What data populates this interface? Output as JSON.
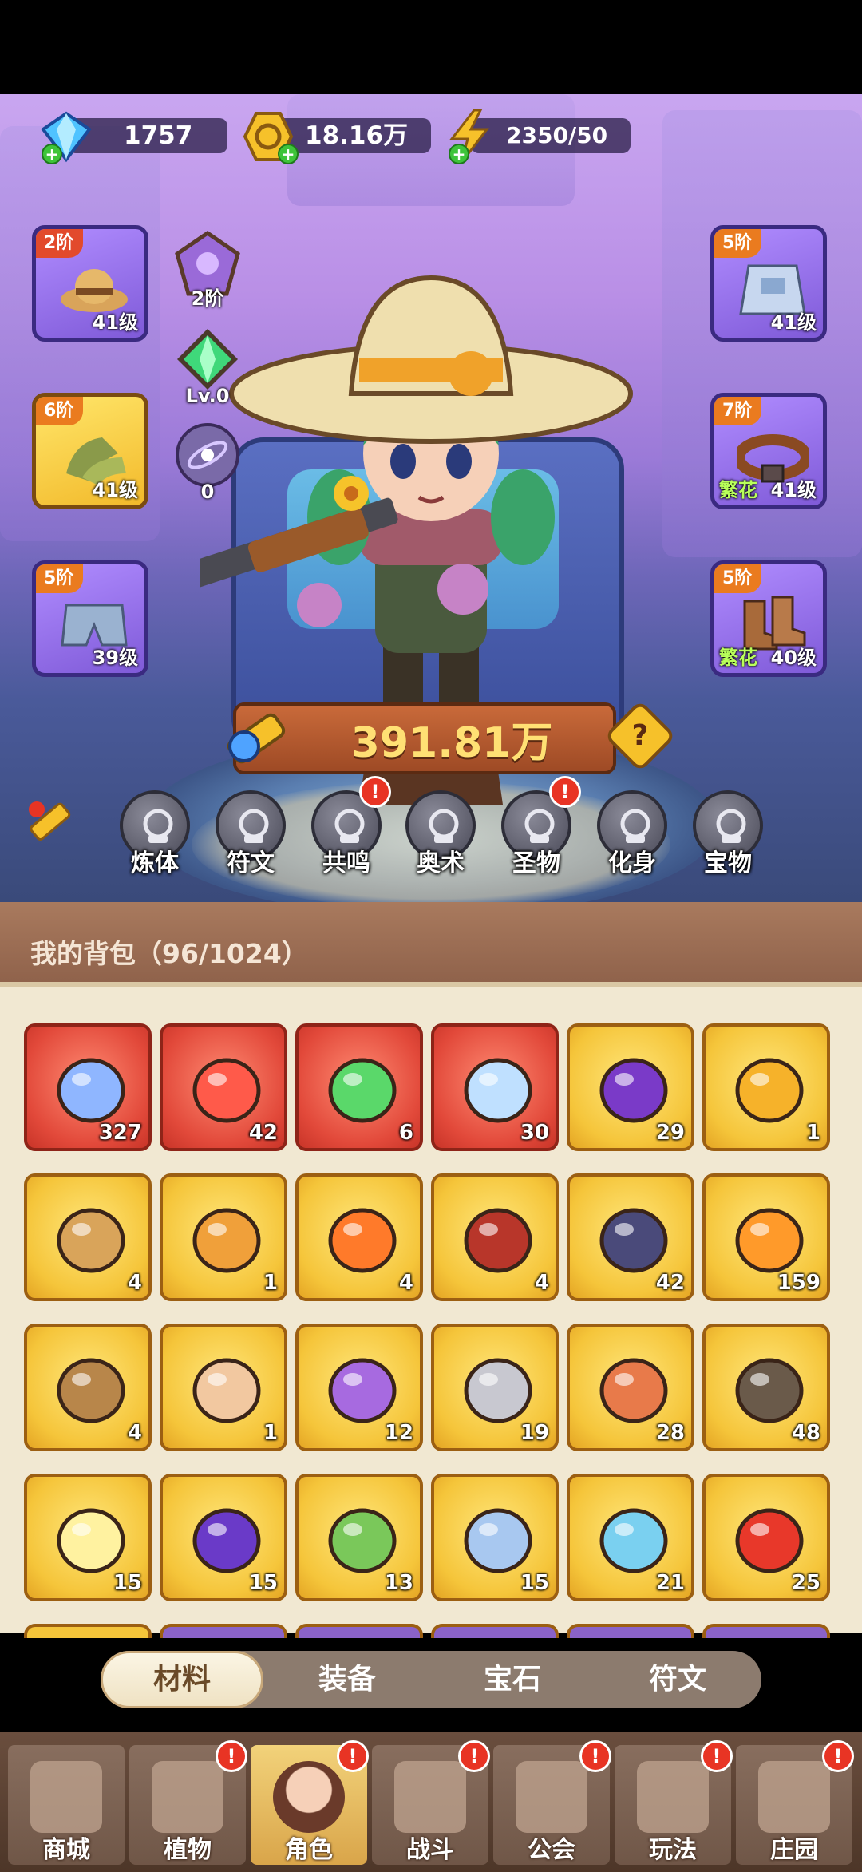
{
  "resources": {
    "gems": "1757",
    "gold": "18.16万",
    "energy": "2350/50"
  },
  "equipment_left": [
    {
      "tier": "2阶",
      "level": "41级",
      "item_icon": "straw-hat-icon"
    },
    {
      "tier": "6阶",
      "level": "41级",
      "item_icon": "gloves-icon"
    },
    {
      "tier": "5阶",
      "level": "39级",
      "item_icon": "shorts-icon"
    }
  ],
  "equipment_right": [
    {
      "tier": "5阶",
      "level": "41级",
      "tag": "",
      "item_icon": "overalls-icon"
    },
    {
      "tier": "7阶",
      "level": "41级",
      "tag": "繁花",
      "item_icon": "belt-icon"
    },
    {
      "tier": "5阶",
      "level": "40级",
      "tag": "繁花",
      "item_icon": "boots-icon"
    }
  ],
  "mini_slots": {
    "crest_tier": "2阶",
    "gem_level": "Lv.0",
    "orb_count": "0"
  },
  "power": {
    "value": "391.81万",
    "help": "?"
  },
  "features": [
    {
      "label": "炼体",
      "badge": false,
      "icon": "body-icon"
    },
    {
      "label": "符文",
      "badge": false,
      "icon": "rune-icon"
    },
    {
      "label": "共鸣",
      "badge": true,
      "icon": "tree-icon"
    },
    {
      "label": "奥术",
      "badge": false,
      "icon": "arcane-icon"
    },
    {
      "label": "圣物",
      "badge": true,
      "icon": "relic-icon"
    },
    {
      "label": "化身",
      "badge": false,
      "icon": "avatar-icon"
    },
    {
      "label": "宝物",
      "badge": false,
      "icon": "treasure-icon"
    }
  ],
  "bag": {
    "title": "我的背包（96/1024）",
    "items": [
      {
        "count": "327",
        "rarity": "red",
        "icon": "crystal-star-icon"
      },
      {
        "count": "42",
        "rarity": "red",
        "icon": "red-potion-icon"
      },
      {
        "count": "6",
        "rarity": "red",
        "icon": "green-canister-icon"
      },
      {
        "count": "30",
        "rarity": "red",
        "icon": "blue-star-icon"
      },
      {
        "count": "29",
        "rarity": "gold",
        "icon": "skull-card-icon"
      },
      {
        "count": "1",
        "rarity": "gold",
        "icon": "ruby-key-icon"
      },
      {
        "count": "4",
        "rarity": "gold",
        "icon": "bronze-key-icon"
      },
      {
        "count": "1",
        "rarity": "gold",
        "icon": "gem-key-icon"
      },
      {
        "count": "4",
        "rarity": "gold",
        "icon": "fire-prism-icon"
      },
      {
        "count": "4",
        "rarity": "gold",
        "icon": "red-book-icon"
      },
      {
        "count": "42",
        "rarity": "gold",
        "icon": "rune-stone-icon"
      },
      {
        "count": "159",
        "rarity": "gold",
        "icon": "orange-potion-icon"
      },
      {
        "count": "4",
        "rarity": "gold",
        "icon": "flower-pot-icon"
      },
      {
        "count": "1",
        "rarity": "gold",
        "icon": "cake-icon"
      },
      {
        "count": "12",
        "rarity": "gold",
        "icon": "purple-book-icon"
      },
      {
        "count": "19",
        "rarity": "gold",
        "icon": "canned-food-icon"
      },
      {
        "count": "28",
        "rarity": "gold",
        "icon": "copper-ore-icon"
      },
      {
        "count": "48",
        "rarity": "gold",
        "icon": "card-swap-icon"
      },
      {
        "count": "15",
        "rarity": "gold",
        "icon": "white-flower-icon"
      },
      {
        "count": "15",
        "rarity": "gold",
        "icon": "grape-icon"
      },
      {
        "count": "13",
        "rarity": "gold",
        "icon": "frog-icon"
      },
      {
        "count": "15",
        "rarity": "gold",
        "icon": "bird-helmet-icon"
      },
      {
        "count": "21",
        "rarity": "gold",
        "icon": "whale-icon"
      },
      {
        "count": "25",
        "rarity": "gold",
        "icon": "fire-spirit-icon"
      }
    ]
  },
  "tabs": [
    {
      "label": "材料",
      "active": true
    },
    {
      "label": "装备",
      "active": false
    },
    {
      "label": "宝石",
      "active": false
    },
    {
      "label": "符文",
      "active": false
    }
  ],
  "nav": [
    {
      "label": "商城",
      "badge": false,
      "active": false
    },
    {
      "label": "植物",
      "badge": true,
      "active": false
    },
    {
      "label": "角色",
      "badge": true,
      "active": true
    },
    {
      "label": "战斗",
      "badge": true,
      "active": false
    },
    {
      "label": "公会",
      "badge": true,
      "active": false
    },
    {
      "label": "玩法",
      "badge": true,
      "active": false
    },
    {
      "label": "庄园",
      "badge": true,
      "active": false
    }
  ],
  "colors": {
    "red_cell": "#e2493a",
    "gold_cell": "#f5c53a",
    "power_text": "#ffe074",
    "badge": "#e83424",
    "tag_green": "#b9ff5a"
  }
}
